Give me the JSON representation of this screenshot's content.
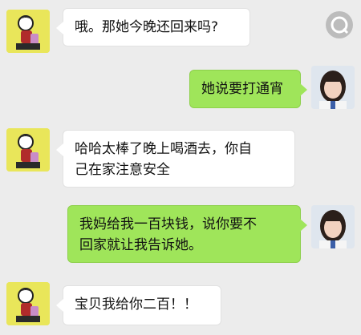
{
  "messages": [
    {
      "side": "left",
      "text": "哦。那她今晚还回来吗?"
    },
    {
      "side": "right",
      "text": "她说要打通宵"
    },
    {
      "side": "left",
      "text": "哈哈太棒了晚上喝酒去，你自\n己在家注意安全"
    },
    {
      "side": "right",
      "text": "我妈给我一百块钱，说你要不\n回家就让我告诉她。"
    },
    {
      "side": "left",
      "text": "宝贝我给你二百！！"
    }
  ],
  "colors": {
    "background": "#ececec",
    "incoming_bubble": "#ffffff",
    "outgoing_bubble": "#9fe55a",
    "left_avatar_bg": "#e9e65a"
  },
  "icons": {
    "left_avatar": "cartoon-avatar-icon",
    "right_avatar": "user-photo-avatar-icon",
    "watermark": "app-watermark-icon"
  }
}
